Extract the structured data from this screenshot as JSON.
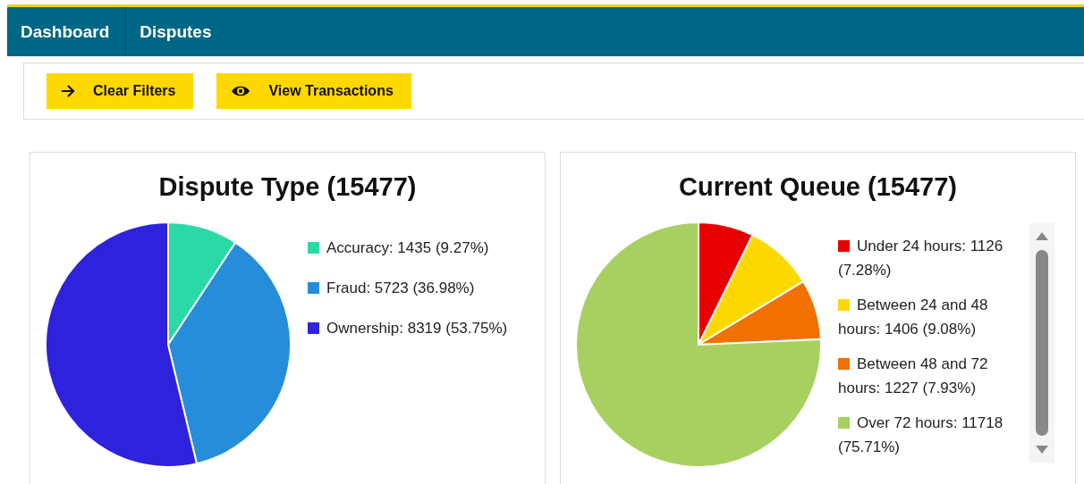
{
  "nav": {
    "items": [
      "Dashboard",
      "Disputes"
    ]
  },
  "toolbar": {
    "buttons": [
      {
        "label": "Clear Filters",
        "kind": "arrow"
      },
      {
        "label": "View Transactions",
        "kind": "eye"
      }
    ]
  },
  "cards": [
    {
      "title": "Dispute Type (15477)",
      "scrollbar": false,
      "legend": [
        {
          "rest": ": 1435 (9.27%)",
          "color": "#2adaa6"
        },
        {
          "rest": ": 5723 (36.98%)",
          "color": "#268ddb"
        },
        {
          "rest": ": 8319 (53.75%)",
          "color": "#2e22dd"
        }
      ],
      "chart_data": {
        "type": "pie",
        "categories": [
          "Accuracy",
          "Fraud",
          "Ownership"
        ],
        "values": [
          9.27,
          36.98,
          53.75
        ]
      }
    },
    {
      "title": "Current Queue (15477)",
      "scrollbar": true,
      "legend": [
        {
          "rest": ": 1126 (7.28%)",
          "color": "#e80000"
        },
        {
          "rest": ": 1406 (9.08%)",
          "color": "#ffd800"
        },
        {
          "rest": ": 1227 (7.93%)",
          "color": "#f07000"
        },
        {
          "rest": ": 11718 (75.71%)",
          "color": "#a8d060"
        }
      ],
      "chart_data": {
        "type": "pie",
        "categories": [
          "Under 24 hours",
          "Between 24 and 48 hours",
          "Between 48 and 72 hours",
          "Over 72 hours"
        ],
        "values": [
          7.28,
          9.08,
          7.93,
          75.71
        ]
      }
    }
  ]
}
